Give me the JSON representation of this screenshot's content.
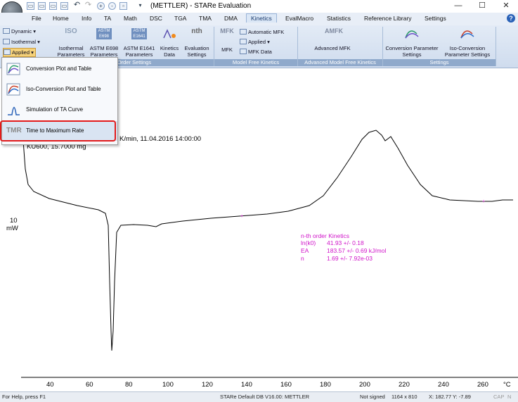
{
  "window": {
    "title": "(METTLER) - STARe Evaluation",
    "controls": [
      "minimize-icon",
      "maximize-icon",
      "close-icon"
    ]
  },
  "quick_access": [
    "open-icon",
    "save-icon",
    "print-icon",
    "copy-icon",
    "undo-icon",
    "redo-icon",
    "zoom-in-icon",
    "zoom-out-icon",
    "window-icon",
    "dropdown-icon"
  ],
  "tabs": [
    "File",
    "Home",
    "Info",
    "TA",
    "Math",
    "DSC",
    "TGA",
    "TMA",
    "DMA",
    "Kinetics",
    "EvalMacro",
    "Statistics",
    "Reference Library",
    "Settings"
  ],
  "active_tab": "Kinetics",
  "ribbon": {
    "left_buttons": [
      "Dynamic",
      "Isothermal",
      "Applied"
    ],
    "group1": {
      "label": "Order Settings",
      "buttons": [
        "Isothermal Parameters",
        "ASTM E698 Parameters",
        "ASTM E1641 Parameters",
        "Kinetics Data",
        "Evaluation Settings"
      ],
      "icon_text": [
        "ISO",
        "ASTM E698",
        "ASTM E1641",
        "",
        "nth"
      ]
    },
    "group2": {
      "label": "Model Free Kinetics",
      "big": "MFK",
      "small": [
        "Automatic MFK",
        "Applied",
        "MFK Data"
      ]
    },
    "group3": {
      "label": "Advanced Model Free Kinetics",
      "big": "Advanced MFK",
      "icon_text": "AMFK"
    },
    "group4": {
      "label": "Settings",
      "buttons": [
        "Conversion Parameter Settings",
        "Iso-Conversion Parameter Settings"
      ]
    }
  },
  "menu": {
    "items": [
      "Conversion Plot and Table",
      "Iso-Conversion Plot and Table",
      "Simulation of TA Curve",
      "Time to Maximum Rate"
    ],
    "tmr_icon": "TMR"
  },
  "plot": {
    "header_text": "K/min, 11.04.2016 14:00:00",
    "sample_text": "KU600, 15.7000 mg",
    "y_scale": "10",
    "y_unit": "mW",
    "kinetics_title": "n-th order Kinetics",
    "kinetics_rows": [
      {
        "name": "ln(k0)",
        "value": "41.93 +/- 0.18"
      },
      {
        "name": "EA",
        "value": "183.57 +/- 0.69 kJ/mol"
      },
      {
        "name": "n",
        "value": "1.69 +/- 7.92e-03"
      }
    ],
    "x_ticks": [
      "40",
      "60",
      "80",
      "100",
      "120",
      "140",
      "160",
      "180",
      "200",
      "220",
      "240",
      "260"
    ],
    "x_unit": "°C",
    "colors": {
      "curve": "#000000",
      "kinetics_text": "#d013c9",
      "highlight": "#e31b1b"
    }
  },
  "status": {
    "help": "For Help, press F1",
    "version": "STARe Default DB V16.00: METTLER",
    "signed": "Not signed",
    "size": "1164 x 810",
    "coords": "X: 182.77 Y: -7.89",
    "caps": "CAP",
    "num": "N"
  }
}
